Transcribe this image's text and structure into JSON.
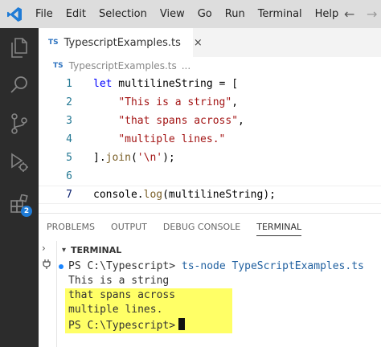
{
  "menu": [
    "File",
    "Edit",
    "Selection",
    "View",
    "Go",
    "Run",
    "Terminal",
    "Help"
  ],
  "nav": {
    "back": "←",
    "forward": "→"
  },
  "activity_bar": {
    "extensions_badge": "2",
    "accent_badge_color": "#1f7bd6"
  },
  "editor_tab": {
    "badge": "TS",
    "label": "TypescriptExamples.ts",
    "close": "×"
  },
  "breadcrumb": {
    "badge": "TS",
    "file": "TypescriptExamples.ts",
    "ellipsis": "..."
  },
  "code": [
    {
      "num": "1",
      "parts": [
        [
          "kw",
          "let"
        ],
        [
          "plain",
          " multilineString = ["
        ]
      ]
    },
    {
      "num": "2",
      "parts": [
        [
          "plain",
          "    "
        ],
        [
          "str",
          "\"This is a string\""
        ],
        [
          "plain",
          ","
        ]
      ]
    },
    {
      "num": "3",
      "parts": [
        [
          "plain",
          "    "
        ],
        [
          "str",
          "\"that spans across\""
        ],
        [
          "plain",
          ","
        ]
      ]
    },
    {
      "num": "4",
      "parts": [
        [
          "plain",
          "    "
        ],
        [
          "str",
          "\"multiple lines.\""
        ]
      ]
    },
    {
      "num": "5",
      "parts": [
        [
          "plain",
          "]."
        ],
        [
          "fn",
          "join"
        ],
        [
          "plain",
          "("
        ],
        [
          "str",
          "'\\n'"
        ],
        [
          "plain",
          ");"
        ]
      ]
    },
    {
      "num": "6",
      "parts": []
    },
    {
      "num": "7",
      "parts": [
        [
          "plain",
          "console."
        ],
        [
          "fn",
          "log"
        ],
        [
          "plain",
          "(multilineString);"
        ]
      ]
    }
  ],
  "panel_tabs": [
    "PROBLEMS",
    "OUTPUT",
    "DEBUG CONSOLE",
    "TERMINAL"
  ],
  "terminal": {
    "section_title": "TERMINAL",
    "prompt1": "PS C:\\Typescript>",
    "command": "ts-node TypeScriptExamples.ts",
    "output": [
      "This is a string",
      "that spans across",
      "multiple lines."
    ],
    "prompt2": "PS C:\\Typescript>"
  }
}
